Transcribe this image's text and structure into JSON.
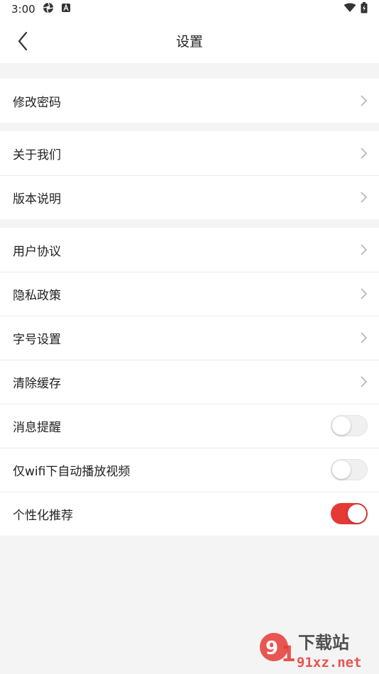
{
  "status_bar": {
    "time": "3:00"
  },
  "header": {
    "title": "设置"
  },
  "groups": [
    {
      "items": [
        {
          "label": "修改密码"
        }
      ]
    },
    {
      "items": [
        {
          "label": "关于我们"
        },
        {
          "label": "版本说明"
        }
      ]
    },
    {
      "items": [
        {
          "label": "用户协议"
        },
        {
          "label": "隐私政策"
        },
        {
          "label": "字号设置"
        },
        {
          "label": "清除缓存"
        },
        {
          "label": "消息提醒",
          "toggle": false
        },
        {
          "label": "仅wifi下自动播放视频",
          "toggle": false
        },
        {
          "label": "个性化推荐",
          "toggle": true
        }
      ]
    }
  ],
  "watermark": {
    "text": "91xz.net",
    "slogan": "下载站"
  },
  "colors": {
    "accent": "#e53935",
    "background": "#f4f4f4",
    "chevron": "#b5b5b5"
  }
}
